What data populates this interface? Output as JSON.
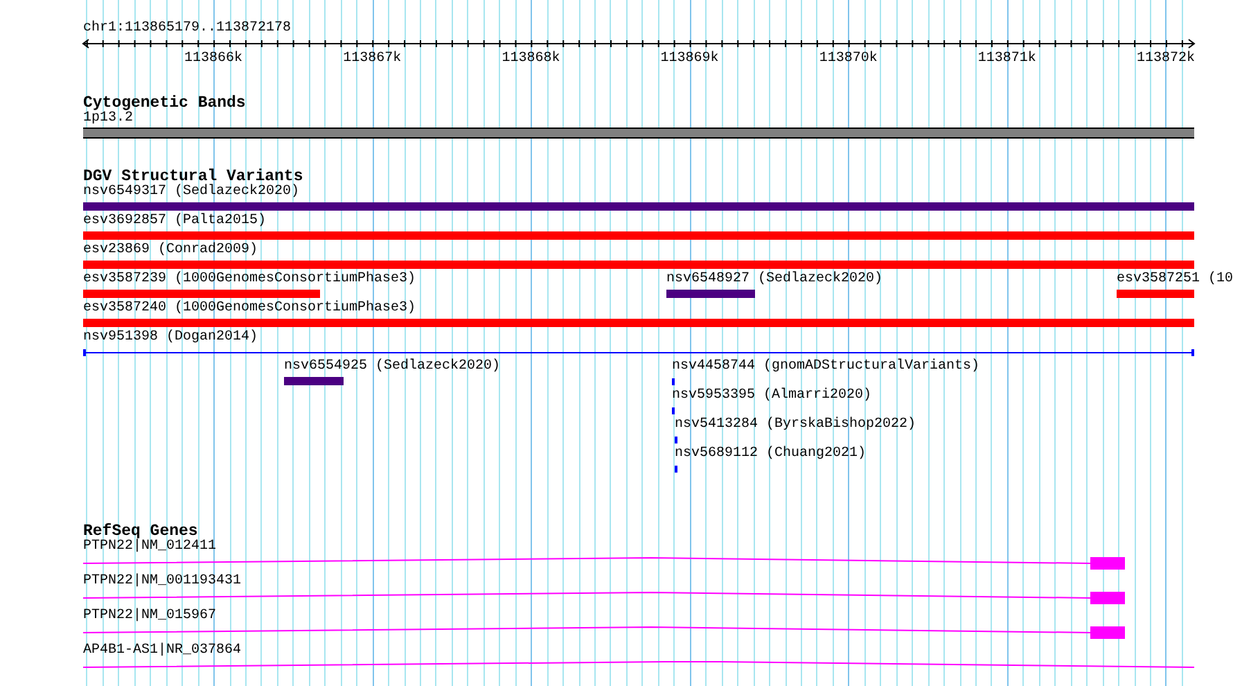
{
  "location": "chr1:113865179..113872178",
  "ruler": {
    "ticks": [
      "113866k",
      "113867k",
      "113868k",
      "113869k",
      "113870k",
      "113871k",
      "113872k"
    ]
  },
  "tracks": [
    {
      "kind": "cytoband",
      "title": "Cytogenetic Bands",
      "bands": [
        {
          "name": "1p13.2"
        }
      ]
    },
    {
      "kind": "variants",
      "title": "DGV Structural Variants",
      "rows": [
        {
          "features": [
            {
              "label": "nsv6549317 (Sedlazeck2020)",
              "kind": "bar",
              "color": "#4b0082"
            }
          ]
        },
        {
          "features": [
            {
              "label": "esv3692857 (Palta2015)",
              "kind": "bar",
              "color": "#ff0000"
            }
          ]
        },
        {
          "features": [
            {
              "label": "esv23869 (Conrad2009)",
              "kind": "bar",
              "color": "#ff0000"
            }
          ]
        },
        {
          "features": [
            {
              "label": "esv3587239 (1000GenomesConsortiumPhase3)",
              "kind": "bar",
              "color": "#ff0000"
            },
            {
              "label": "nsv6548927 (Sedlazeck2020)",
              "kind": "bar",
              "color": "#4b0082"
            },
            {
              "label": "esv3587251 (10",
              "kind": "bar",
              "color": "#ff0000"
            }
          ]
        },
        {
          "features": [
            {
              "label": "esv3587240 (1000GenomesConsortiumPhase3)",
              "kind": "bar",
              "color": "#ff0000"
            }
          ]
        },
        {
          "features": [
            {
              "label": "nsv951398 (Dogan2014)",
              "kind": "span",
              "color": "#0000ff"
            }
          ]
        },
        {
          "features": [
            {
              "label": "nsv6554925 (Sedlazeck2020)",
              "kind": "bar",
              "color": "#4b0082"
            },
            {
              "label": "nsv4458744 (gnomADStructuralVariants)",
              "kind": "bar",
              "color": "#0000ff"
            }
          ]
        },
        {
          "features": [
            {
              "label": "nsv5953395 (Almarri2020)",
              "kind": "bar",
              "color": "#0000ff"
            }
          ]
        },
        {
          "features": [
            {
              "label": "nsv5413284 (ByrskaBishop2022)",
              "kind": "bar",
              "color": "#0000ff"
            }
          ]
        },
        {
          "features": [
            {
              "label": "nsv5689112 (Chuang2021)",
              "kind": "bar",
              "color": "#0000ff"
            }
          ]
        }
      ]
    },
    {
      "kind": "genes",
      "title": "RefSeq Genes",
      "genes": [
        {
          "label": "PTPN22|NM_012411",
          "kind": "coding"
        },
        {
          "label": "PTPN22|NM_001193431",
          "kind": "coding"
        },
        {
          "label": "PTPN22|NM_015967",
          "kind": "coding"
        },
        {
          "label": "AP4B1-AS1|NR_037864",
          "kind": "noncoding"
        }
      ]
    }
  ]
}
